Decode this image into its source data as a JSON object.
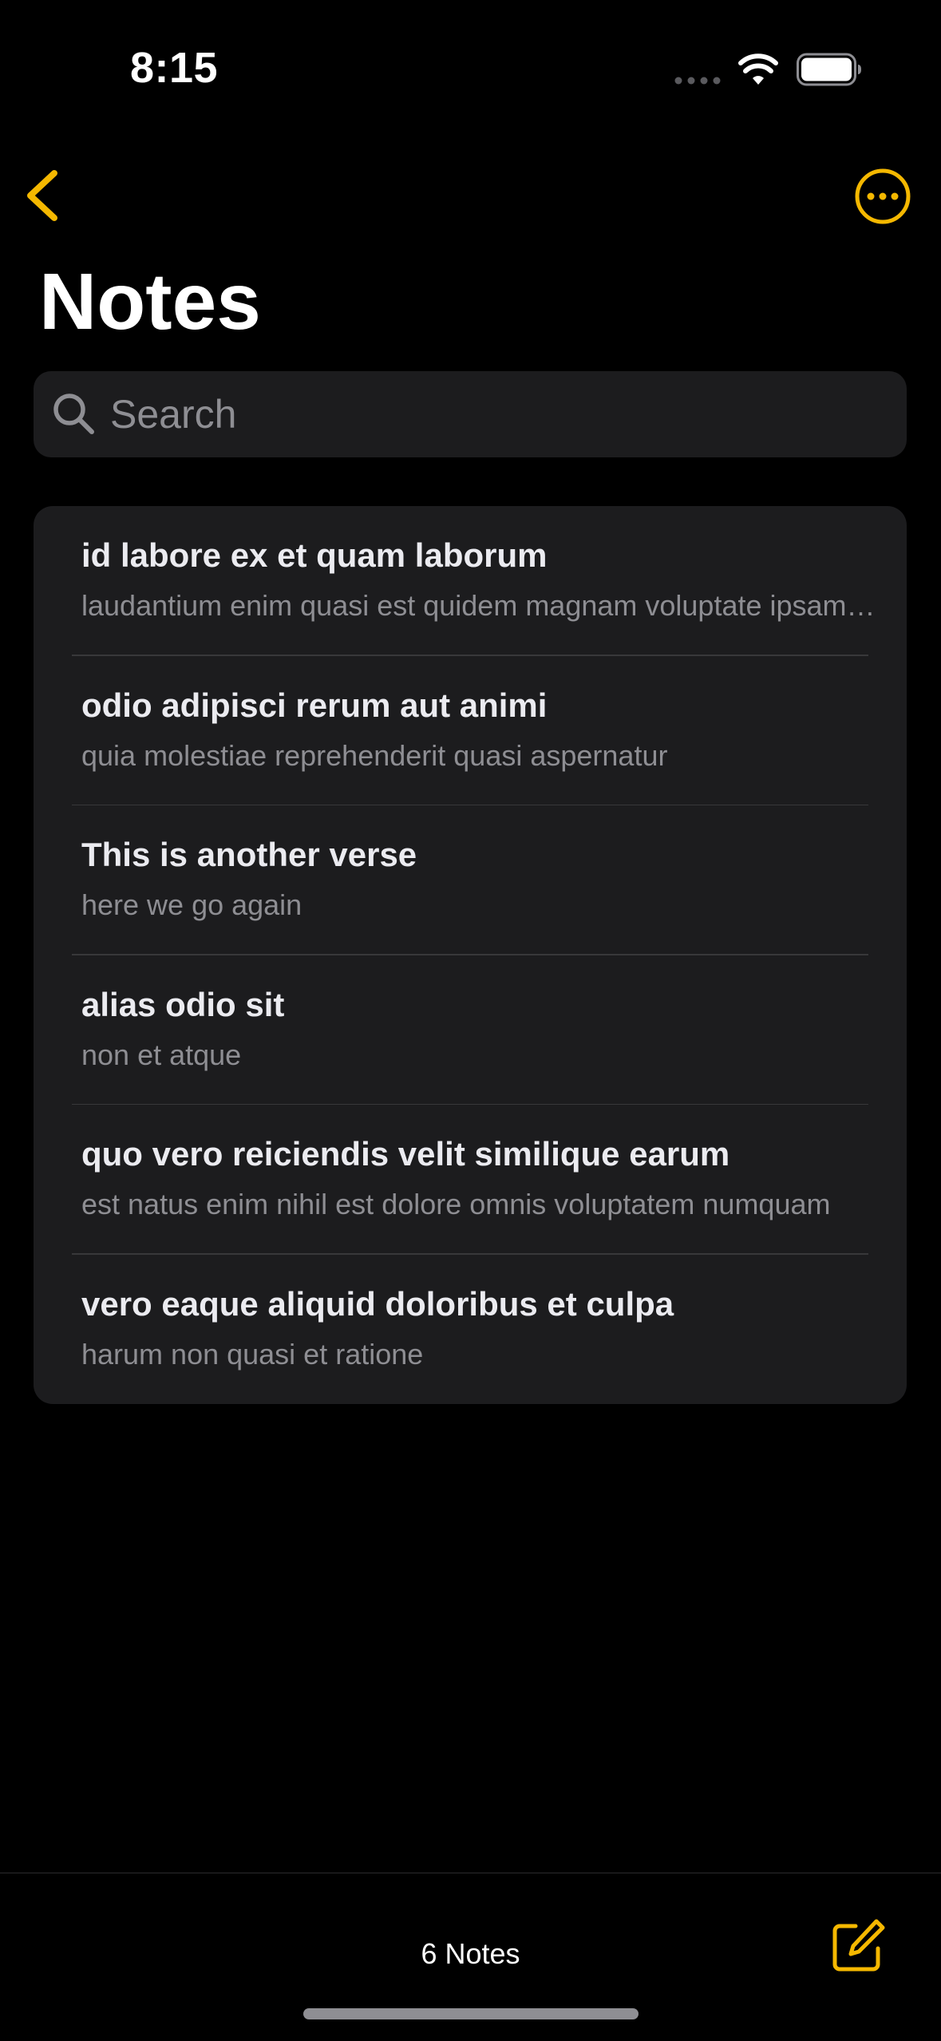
{
  "status_bar": {
    "time": "8:15"
  },
  "nav": {
    "title": "Notes",
    "back_icon": "chevron-left-icon",
    "more_icon": "ellipsis-circle-icon"
  },
  "search": {
    "placeholder": "Search",
    "value": ""
  },
  "notes": [
    {
      "title": "id labore ex et quam laborum",
      "preview": "laudantium enim quasi est quidem magnam voluptate ipsam eos"
    },
    {
      "title": "odio adipisci rerum aut animi",
      "preview": "quia molestiae reprehenderit quasi aspernatur"
    },
    {
      "title": "This is another verse",
      "preview": "here we go again"
    },
    {
      "title": "alias odio sit",
      "preview": "non et atque"
    },
    {
      "title": "quo vero reiciendis velit similique earum",
      "preview": "est natus enim nihil est dolore omnis voluptatem numquam"
    },
    {
      "title": "vero eaque aliquid doloribus et culpa",
      "preview": "harum non quasi et ratione"
    }
  ],
  "toolbar": {
    "count_label": "6 Notes",
    "compose_icon": "square-pencil-icon"
  },
  "colors": {
    "accent": "#F5B800",
    "background": "#000000",
    "card": "#1C1C1E",
    "secondary_text": "#8E8E93"
  }
}
